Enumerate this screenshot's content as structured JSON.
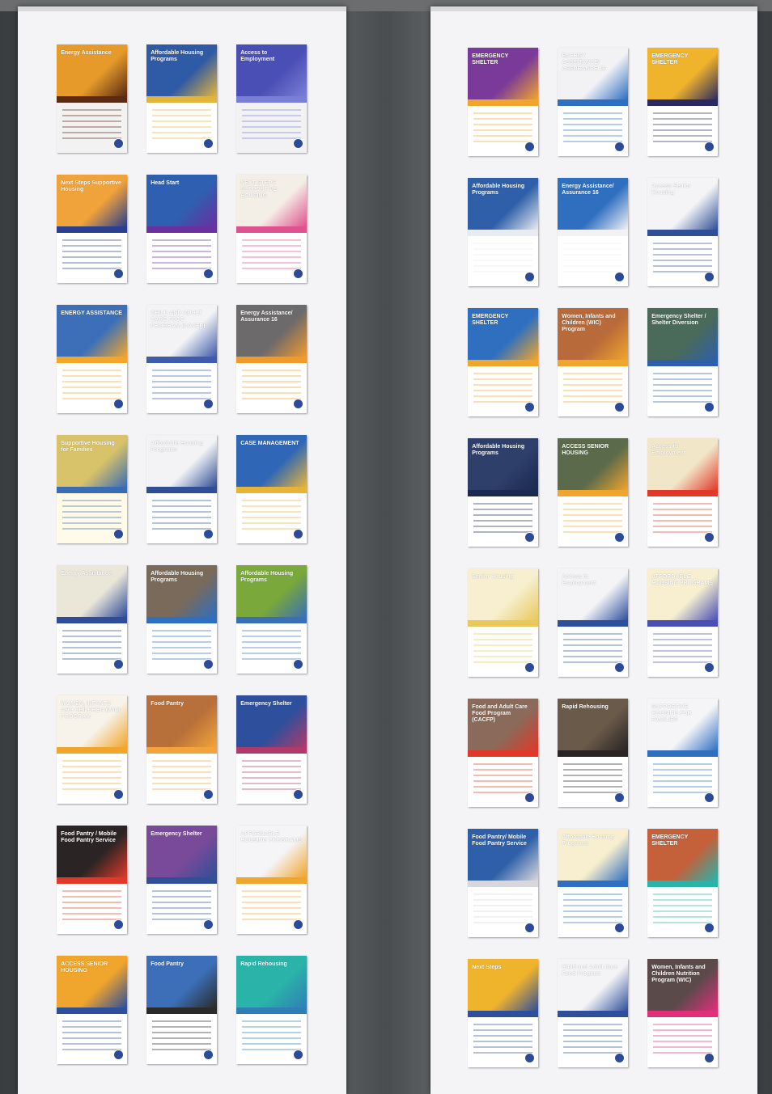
{
  "left_banner": {
    "posters": [
      {
        "title": "Energy Assistance",
        "c1": "#e59a2a",
        "c2": "#5a2a12",
        "c3": "#f2f2f2"
      },
      {
        "title": "Affordable Housing Programs",
        "c1": "#2f5aa6",
        "c2": "#e3b43a",
        "c3": "#ffffff"
      },
      {
        "title": "Access to Employment",
        "c1": "#4a4fb5",
        "c2": "#7a7fd6",
        "c3": "#f2f2f5"
      },
      {
        "title": "Next Steps Supportive Housing",
        "c1": "#f0a23b",
        "c2": "#2a3f8f",
        "c3": "#ffffff"
      },
      {
        "title": "Head Start",
        "c1": "#2e5fb0",
        "c2": "#6a2fa0",
        "c3": "#ffffff"
      },
      {
        "title": "NEXT STEPS SUPPORTIVE HOUSING",
        "c1": "#f4efe6",
        "c2": "#e0528f",
        "c3": "#ffffff"
      },
      {
        "title": "ENERGY ASSISTANCE",
        "c1": "#3c6fb8",
        "c2": "#f2a62c",
        "c3": "#ffffff"
      },
      {
        "title": "CHILD AND ADULT CARE FOOD PROGRAM (CACFP)",
        "c1": "#f3f3f6",
        "c2": "#3e5cab",
        "c3": "#ffffff"
      },
      {
        "title": "Energy Assistance/ Assurance 16",
        "c1": "#6d6a6b",
        "c2": "#f09a2c",
        "c3": "#ffffff"
      },
      {
        "title": "Supportive Housing for Families",
        "c1": "#d9c36a",
        "c2": "#3a6cb3",
        "c3": "#fffbe8"
      },
      {
        "title": "Affordable Housing Programs",
        "c1": "#f3f3f6",
        "c2": "#2f4f96",
        "c3": "#ffffff"
      },
      {
        "title": "CASE MANAGEMENT",
        "c1": "#2f67b6",
        "c2": "#e7b43a",
        "c3": "#ffffff"
      },
      {
        "title": "Energy Assistance",
        "c1": "#eae6d8",
        "c2": "#2e4c98",
        "c3": "#ffffff"
      },
      {
        "title": "Affordable Housing Programs",
        "c1": "#7a6a5a",
        "c2": "#2e6fc0",
        "c3": "#ffffff"
      },
      {
        "title": "Affordable Housing Programs",
        "c1": "#7aa83a",
        "c2": "#3a6fb6",
        "c3": "#ffffff"
      },
      {
        "title": "WOMEN, INFANTS AND CHILDREN (WIC) PROGRAM",
        "c1": "#f7f3ea",
        "c2": "#f0a52c",
        "c3": "#ffffff"
      },
      {
        "title": "Food Pantry",
        "c1": "#b8703a",
        "c2": "#f1a43a",
        "c3": "#ffffff"
      },
      {
        "title": "Emergency Shelter",
        "c1": "#2e4f9c",
        "c2": "#b03a6a",
        "c3": "#ffffff"
      },
      {
        "title": "Food Pantry / Mobile Food Pantry Service",
        "c1": "#2a2424",
        "c2": "#e0392a",
        "c3": "#ffffff"
      },
      {
        "title": "Emergency Shelter",
        "c1": "#7a4a9a",
        "c2": "#2f4f96",
        "c3": "#ffffff"
      },
      {
        "title": "AFFORDABLE HOUSING PROGRAMS",
        "c1": "#f5f5f7",
        "c2": "#f0a52c",
        "c3": "#ffffff"
      },
      {
        "title": "ACCESS SENIOR HOUSING",
        "c1": "#f0a52c",
        "c2": "#2e4f9c",
        "c3": "#ffffff"
      },
      {
        "title": "Food Pantry",
        "c1": "#3c6fb8",
        "c2": "#2a2a2a",
        "c3": "#ffffff"
      },
      {
        "title": "Rapid Rehousing",
        "c1": "#2ab3a8",
        "c2": "#2f7fb6",
        "c3": "#ffffff"
      }
    ]
  },
  "right_banner": {
    "posters": [
      {
        "title": "EMERGENCY SHELTER",
        "c1": "#7a3a9a",
        "c2": "#f0a52c",
        "c3": "#ffffff"
      },
      {
        "title": "ENERGY ASSISTANCE/ ASSURANCE 16",
        "c1": "#f2f2f5",
        "c2": "#2e6fc0",
        "c3": "#ffffff"
      },
      {
        "title": "EMERGENCY SHELTER",
        "c1": "#f0b42c",
        "c2": "#2a2a60",
        "c3": "#ffffff"
      },
      {
        "title": "Affordable Housing Programs",
        "c1": "#2e5fa8",
        "c2": "#e8ecf2",
        "c3": "#ffffff"
      },
      {
        "title": "Energy Assistance/ Assurance 16",
        "c1": "#2e6fc0",
        "c2": "#f2f2f5",
        "c3": "#ffffff"
      },
      {
        "title": "Access Senior Housing",
        "c1": "#f4f4f6",
        "c2": "#2f4f96",
        "c3": "#ffffff"
      },
      {
        "title": "EMERGENCY SHELTER",
        "c1": "#2e6fc0",
        "c2": "#f0a52c",
        "c3": "#ffffff"
      },
      {
        "title": "Women, Infants and Children (WIC) Program",
        "c1": "#b86a3a",
        "c2": "#f0a52c",
        "c3": "#ffffff"
      },
      {
        "title": "Emergency Shelter / Shelter Diversion",
        "c1": "#4a6a5a",
        "c2": "#2f5fa8",
        "c3": "#ffffff"
      },
      {
        "title": "Affordable Housing Programs",
        "c1": "#2e3f6a",
        "c2": "#1a2a50",
        "c3": "#ffffff"
      },
      {
        "title": "ACCESS SENIOR HOUSING",
        "c1": "#5a6a4a",
        "c2": "#f0a52c",
        "c3": "#ffffff"
      },
      {
        "title": "Access to Employment",
        "c1": "#f2e6c8",
        "c2": "#e0392a",
        "c3": "#ffffff"
      },
      {
        "title": "Senior Housing",
        "c1": "#f7efcf",
        "c2": "#e8c85a",
        "c3": "#ffffff"
      },
      {
        "title": "Access to Employment",
        "c1": "#f4f4f6",
        "c2": "#2e4f9c",
        "c3": "#ffffff"
      },
      {
        "title": "AFFORDABLE HOUSING PROGRAMS",
        "c1": "#f7efcf",
        "c2": "#4a4fb5",
        "c3": "#ffffff"
      },
      {
        "title": "Food and Adult Care Food Program (CACFP)",
        "c1": "#8a6a5a",
        "c2": "#e0392a",
        "c3": "#ffffff"
      },
      {
        "title": "Rapid Rehousing",
        "c1": "#6a5a4a",
        "c2": "#2a2424",
        "c3": "#ffffff"
      },
      {
        "title": "SUPPORTIVE HOUSING FOR FAMILIES",
        "c1": "#f5f5f7",
        "c2": "#2e6fc0",
        "c3": "#ffffff"
      },
      {
        "title": "Food Pantry/ Mobile Food Pantry Service",
        "c1": "#2e5fa8",
        "c2": "#d8d8dc",
        "c3": "#ffffff"
      },
      {
        "title": "Affordable Housing Programs",
        "c1": "#f7efcf",
        "c2": "#2e6fc0",
        "c3": "#ffffff"
      },
      {
        "title": "EMERGENCY SHELTER",
        "c1": "#c4603a",
        "c2": "#2ab3a8",
        "c3": "#ffffff"
      },
      {
        "title": "Next Steps",
        "c1": "#f0b42c",
        "c2": "#2e4f9c",
        "c3": "#ffffff"
      },
      {
        "title": "Child and Adult Care Food Program",
        "c1": "#f4f4f6",
        "c2": "#2e4f9c",
        "c3": "#ffffff"
      },
      {
        "title": "Women, Infants and Children Nutrition Program (WIC)",
        "c1": "#5a4a4a",
        "c2": "#e0307a",
        "c3": "#ffffff"
      }
    ]
  }
}
